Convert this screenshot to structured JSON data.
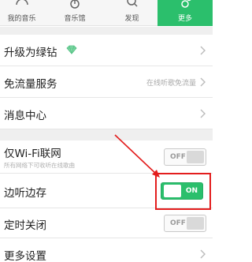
{
  "tabs": [
    {
      "label": "我的音乐",
      "icon": "headphones-icon"
    },
    {
      "label": "音乐馆",
      "icon": "music-note-icon"
    },
    {
      "label": "发现",
      "icon": "search-icon"
    },
    {
      "label": "更多",
      "icon": "more-circles-icon"
    }
  ],
  "settings": {
    "upgrade": {
      "title": "升级为绿钻",
      "icon": "diamond-icon"
    },
    "free_data": {
      "title": "免流量服务",
      "value": "在线听歌免流量"
    },
    "messages": {
      "title": "消息中心"
    },
    "wifi_only": {
      "title": "仅Wi-Fi联网",
      "subtitle": "所有网络下可收听在线歌曲",
      "toggle": "OFF"
    },
    "listen_save": {
      "title": "边听边存",
      "toggle": "ON"
    },
    "sleep_timer": {
      "title": "定时关闭",
      "toggle": "OFF"
    },
    "more_settings": {
      "title": "更多设置"
    }
  },
  "colors": {
    "accent": "#2bbf6c",
    "annotation": "#e31d1d"
  }
}
